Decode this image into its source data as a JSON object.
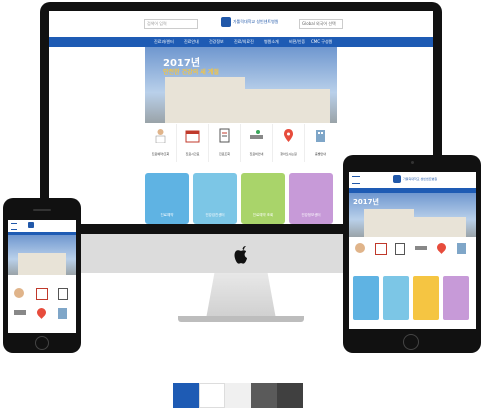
{
  "site": {
    "search_placeholder": "검색어 입력",
    "logo_text": "가톨릭대학교 성빈센트병원",
    "lang_label": "Global  외국어 선택",
    "nav": [
      "진료과/센터",
      "진료안내",
      "건강정보",
      "진료/의료진",
      "병원소개",
      "비젼/인증",
      "CMC 구성원"
    ],
    "hero_year": "2017년",
    "hero_subtitle": "안전한 건강의 새 계절",
    "quick_links": [
      "진료예약/조회",
      "진료시간표",
      "진료조회",
      "진료비안내",
      "찾아오시는길",
      "층별안내"
    ],
    "cards": [
      "진료예약",
      "건강검진센터",
      "진료예약 조회",
      "건강정보센터"
    ],
    "card_colors": [
      "#5fb3e3",
      "#7cc6e6",
      "#a9d46a",
      "#f5c542",
      "#c79ad8"
    ]
  },
  "devices": {
    "imac_logo": "apple-logo",
    "ipad_logo": "가톨릭대학교 성빈센트병원"
  },
  "palette": [
    "#1e5bb4",
    "#ffffff",
    "#f0f0f0",
    "#5a5a5a",
    "#404040"
  ]
}
